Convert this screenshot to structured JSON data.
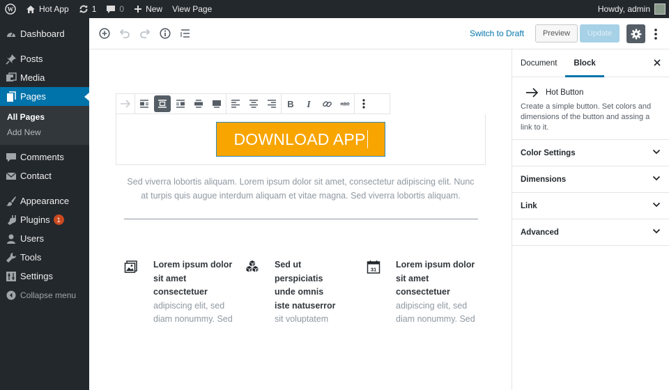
{
  "admin_bar": {
    "site_name": "Hot App",
    "updates_count": "1",
    "comments_count": "0",
    "new_label": "New",
    "view_page_label": "View Page",
    "greeting": "Howdy, admin"
  },
  "sidebar": {
    "items": [
      {
        "label": "Dashboard",
        "icon": "dashboard-icon"
      },
      {
        "label": "Posts",
        "icon": "pin-icon"
      },
      {
        "label": "Media",
        "icon": "media-icon"
      },
      {
        "label": "Pages",
        "icon": "pages-icon"
      },
      {
        "label": "Comments",
        "icon": "comment-icon"
      },
      {
        "label": "Contact",
        "icon": "mail-icon"
      },
      {
        "label": "Appearance",
        "icon": "brush-icon"
      },
      {
        "label": "Plugins",
        "icon": "plugin-icon",
        "badge": "1"
      },
      {
        "label": "Users",
        "icon": "user-icon"
      },
      {
        "label": "Tools",
        "icon": "wrench-icon"
      },
      {
        "label": "Settings",
        "icon": "settings-icon"
      }
    ],
    "submenu": {
      "all_pages": "All Pages",
      "add_new": "Add New"
    },
    "collapse_label": "Collapse menu"
  },
  "header": {
    "switch_to_draft": "Switch to Draft",
    "preview": "Preview",
    "update": "Update"
  },
  "canvas": {
    "button_text": "DOWNLOAD APP",
    "paragraph": "Sed viverra lobortis aliquam. Lorem ipsum dolor sit amet, consectetur adipiscing elit. Nunc at turpis quis augue interdum aliquam et vitae magna. Sed viverra lobortis aliquam.",
    "features": [
      {
        "icon": "image-icon",
        "bold": "Lorem ipsum dolor sit amet consectetuer",
        "light": "adipiscing elit, sed diam nonummy. Sed"
      },
      {
        "icon": "cubes-icon",
        "bold": "Sed ut perspiciatis unde omnis iste natuserror",
        "light": "sit voluptatem"
      },
      {
        "icon": "calendar-icon",
        "bold": "Lorem ipsum dolor sit amet consectetuer",
        "light": "adipiscing elit, sed diam nonummy. Sed",
        "calendar_day": "31"
      }
    ]
  },
  "panel": {
    "tab_document": "Document",
    "tab_block": "Block",
    "block_title": "Hot Button",
    "block_description": "Create a simple button. Set colors and dimensions of the button and assing a link to it.",
    "sections": [
      "Color Settings",
      "Dimensions",
      "Link",
      "Advanced"
    ]
  },
  "colors": {
    "admin_dark": "#23282d",
    "accent_blue": "#0073aa",
    "button_orange": "#f8a500"
  }
}
